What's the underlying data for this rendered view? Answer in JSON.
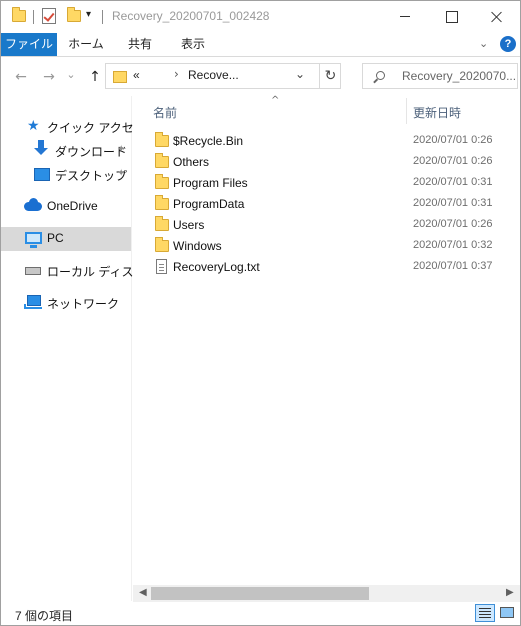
{
  "window": {
    "title": "Recovery_20200701_002428"
  },
  "ribbon": {
    "tabs": [
      {
        "label": "ファイル"
      },
      {
        "label": "ホーム"
      },
      {
        "label": "共有"
      },
      {
        "label": "表示"
      }
    ],
    "help_label": "?"
  },
  "nav": {
    "back_icon": "←",
    "forward_icon": "→",
    "recent_icon": "⌄",
    "up_icon": "↑",
    "address": {
      "overflow": "«",
      "separator": "›",
      "current": "Recove...",
      "dropdown_icon": "⌄",
      "refresh_icon": "↻"
    },
    "search_placeholder": "Recovery_2020070..."
  },
  "sidebar": {
    "items": [
      {
        "label": "クイック アクセス"
      },
      {
        "label": "ダウンロード"
      },
      {
        "label": "デスクトップ"
      },
      {
        "label": "OneDrive"
      },
      {
        "label": "PC"
      },
      {
        "label": "ローカル ディスク (E"
      },
      {
        "label": "ネットワーク"
      }
    ],
    "pin_icon": "📌"
  },
  "columns": {
    "name": "名前",
    "date": "更新日時",
    "sort_arrow": "^"
  },
  "files": [
    {
      "name": "$Recycle.Bin",
      "date": "2020/07/01 0:26",
      "kind": "folder"
    },
    {
      "name": "Others",
      "date": "2020/07/01 0:26",
      "kind": "folder"
    },
    {
      "name": "Program Files",
      "date": "2020/07/01 0:31",
      "kind": "folder"
    },
    {
      "name": "ProgramData",
      "date": "2020/07/01 0:31",
      "kind": "folder"
    },
    {
      "name": "Users",
      "date": "2020/07/01 0:26",
      "kind": "folder"
    },
    {
      "name": "Windows",
      "date": "2020/07/01 0:32",
      "kind": "folder"
    },
    {
      "name": "RecoveryLog.txt",
      "date": "2020/07/01 0:37",
      "kind": "text-file"
    }
  ],
  "scrollbar": {
    "left_arrow": "◀",
    "right_arrow": "▶"
  },
  "status": {
    "item_count": "7 個の項目"
  },
  "colors": {
    "accent": "#1979ca",
    "folder": "#ffd864",
    "selection": "#d9d9d9"
  }
}
